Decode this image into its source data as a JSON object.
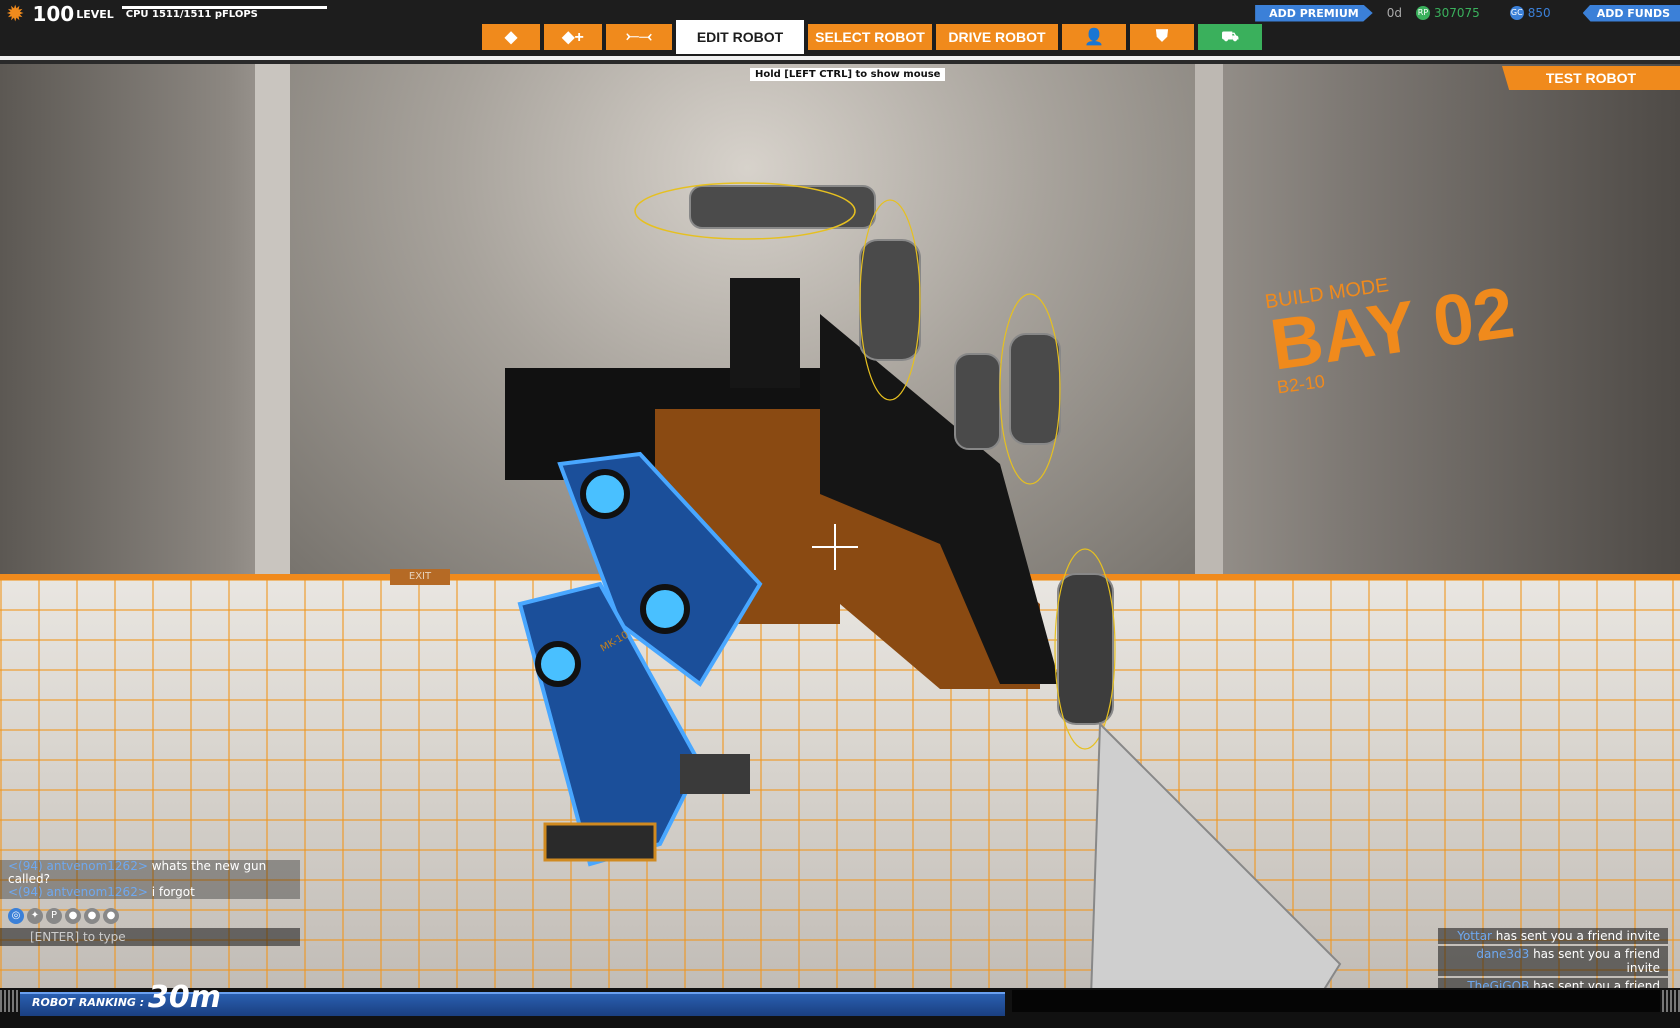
{
  "header": {
    "level_value": "100",
    "level_label": "LEVEL",
    "cpu_text": "CPU 1511/1511 pFLOPS",
    "add_premium_label": "ADD PREMIUM",
    "premium_time": "0d",
    "rp_amount": "307075",
    "gc_amount": "850",
    "add_funds_label": "ADD FUNDS",
    "rp_icon_text": "RP",
    "gc_icon_text": "GC"
  },
  "tabs": {
    "edit_robot": "EDIT ROBOT",
    "select_robot": "SELECT ROBOT",
    "drive_robot": "DRIVE ROBOT"
  },
  "hint": "Hold [LEFT CTRL] to show mouse",
  "test_robot_label": "TEST ROBOT",
  "scene": {
    "bay_line1": "BUILD MODE",
    "bay_line2": "BAY 02",
    "bay_line3": "B2-10",
    "exit_label": "EXIT",
    "leg_label": "MK-10"
  },
  "chat": {
    "messages": [
      {
        "who": "<(94) antvenom1262>",
        "text": " whats the new gun"
      },
      {
        "who": "",
        "text": "called?"
      },
      {
        "who": "<(94) antvenom1262>",
        "text": " i forgot"
      }
    ],
    "input_placeholder": "[ENTER] to type"
  },
  "notifications": [
    {
      "name": "Yottar",
      "text": " has sent you a friend invite"
    },
    {
      "name": "dane3d3",
      "text": " has sent you a friend invite"
    },
    {
      "name": "TheGiGOB",
      "text": " has sent you a friend invite"
    }
  ],
  "ranking": {
    "label": "ROBOT RANKING :",
    "value": "30m"
  },
  "colors": {
    "accent": "#f08a1c",
    "premium_blue": "#3b80d8",
    "rp_green": "#3ab05c"
  },
  "icons": {
    "settings": "gear-icon",
    "cube": "cube-icon",
    "cube_add": "cube-add-icon",
    "share": "share-icon",
    "friends": "friends-icon",
    "shield": "shield-icon",
    "garage": "garage-icon"
  }
}
